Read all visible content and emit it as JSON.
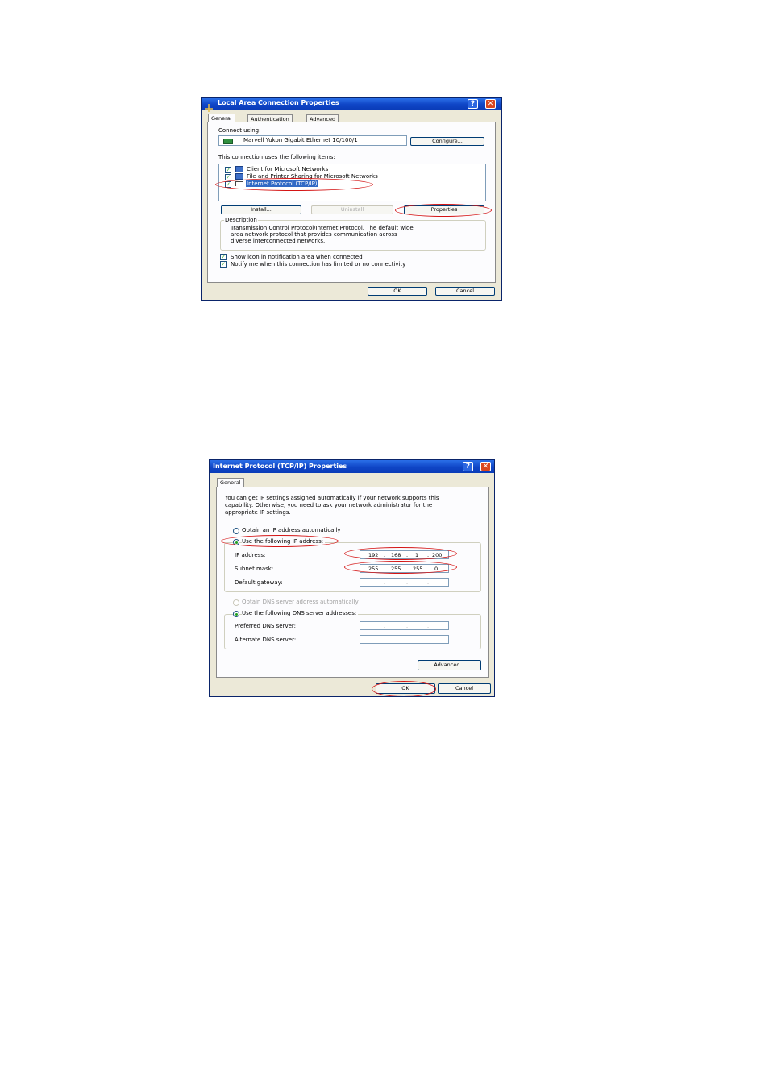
{
  "dialog1": {
    "title": "Local Area Connection Properties",
    "help_glyph": "?",
    "close_glyph": "✕",
    "tabs": [
      "General",
      "Authentication",
      "Advanced"
    ],
    "connect_using_label": "Connect using:",
    "adapter_name": "Marvell Yukon Gigabit Ethernet 10/100/1",
    "configure_label": "Configure...",
    "items_label": "This connection uses the following items:",
    "items": [
      {
        "label": "Client for Microsoft Networks",
        "checked": true
      },
      {
        "label": "File and Printer Sharing for Microsoft Networks",
        "checked": true
      },
      {
        "label": "Internet Protocol (TCP/IP)",
        "checked": true,
        "selected": true
      }
    ],
    "install_label": "Install...",
    "uninstall_label": "Uninstall",
    "properties_label": "Properties",
    "description_legend": "Description",
    "description_lines": [
      "Transmission Control Protocol/Internet Protocol. The default wide",
      "area network protocol that provides communication across",
      "diverse interconnected networks."
    ],
    "show_icon_label": "Show icon in notification area when connected",
    "notify_label": "Notify me when this connection has limited or no connectivity",
    "ok_label": "OK",
    "cancel_label": "Cancel"
  },
  "dialog2": {
    "title": "Internet Protocol (TCP/IP) Properties",
    "help_glyph": "?",
    "close_glyph": "✕",
    "tabs": [
      "General"
    ],
    "intro_lines": [
      "You can get IP settings assigned automatically if your network supports this",
      "capability. Otherwise, you need to ask your network administrator for the",
      "appropriate IP settings."
    ],
    "obtain_ip_label": "Obtain an IP address automatically",
    "use_ip_label": "Use the following IP address:",
    "ip_label": "IP address:",
    "ip_octets": [
      "192",
      "168",
      "1",
      "200"
    ],
    "subnet_label": "Subnet mask:",
    "subnet_octets": [
      "255",
      "255",
      "255",
      "0"
    ],
    "gateway_label": "Default gateway:",
    "obtain_dns_label": "Obtain DNS server address automatically",
    "use_dns_label": "Use the following DNS server addresses:",
    "preferred_dns_label": "Preferred DNS server:",
    "alternate_dns_label": "Alternate DNS server:",
    "dot": ".",
    "advanced_label": "Advanced...",
    "ok_label": "OK",
    "cancel_label": "Cancel"
  },
  "colors": {
    "titlebar": "#0f45c6",
    "dialog_bg": "#ece9d8",
    "highlight_oval": "#d41414",
    "selection": "#316ac5"
  }
}
